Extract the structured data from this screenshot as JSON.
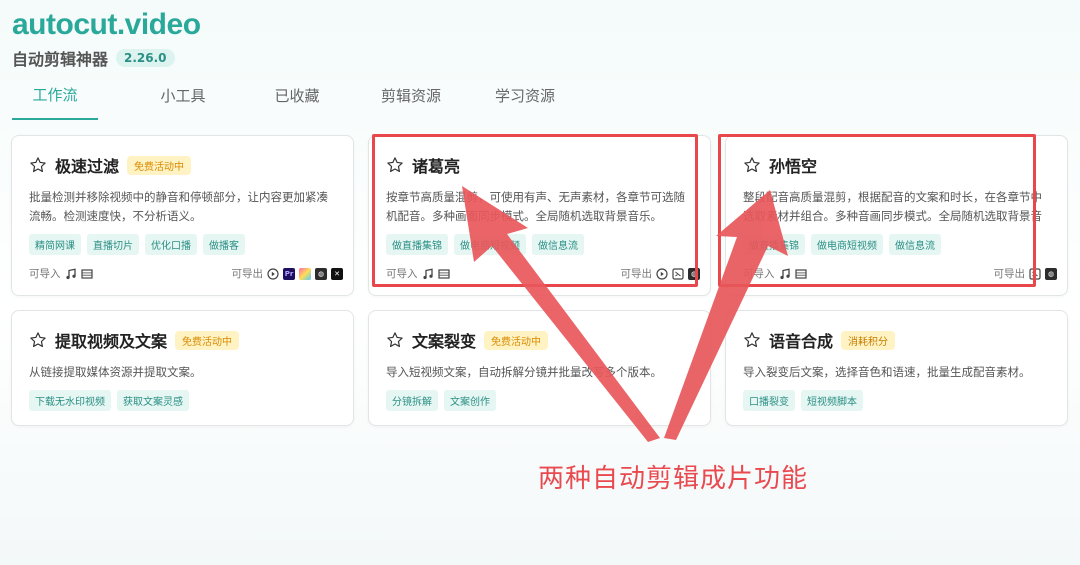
{
  "brand": {
    "logo": "autocut.video",
    "tagline": "自动剪辑神器",
    "version": "2.26.0"
  },
  "tabs": [
    {
      "label": "工作流",
      "active": true
    },
    {
      "label": "小工具",
      "active": false
    },
    {
      "label": "已收藏",
      "active": false
    },
    {
      "label": "剪辑资源",
      "active": false
    },
    {
      "label": "学习资源",
      "active": false
    }
  ],
  "labels": {
    "import": "可导入",
    "export": "可导出"
  },
  "cards": [
    {
      "title": "极速过滤",
      "badge": "免费活动中",
      "desc": "批量检测并移除视频中的静音和停顿部分，让内容更加紧凑流畅。检测速度快，不分析语义。",
      "tags": [
        "精简网课",
        "直播切片",
        "优化口播",
        "做播客"
      ]
    },
    {
      "title": "诸葛亮",
      "badge": "",
      "desc": "按章节高质量混剪，可使用有声、无声素材，各章节可选随机配音。多种画面同步模式。全局随机选取背景音乐。",
      "tags": [
        "做直播集锦",
        "做电商短视频",
        "做信息流"
      ]
    },
    {
      "title": "孙悟空",
      "badge": "",
      "desc": "整段配音高质量混剪，根据配音的文案和时长，在各章节中选取素材并组合。多种音画同步模式。全局随机选取背景音乐。",
      "tags": [
        "做直播集锦",
        "做电商短视频",
        "做信息流"
      ]
    },
    {
      "title": "提取视频及文案",
      "badge": "免费活动中",
      "desc": "从链接提取媒体资源并提取文案。",
      "tags": [
        "下载无水印视频",
        "获取文案灵感"
      ]
    },
    {
      "title": "文案裂变",
      "badge": "免费活动中",
      "desc": "导入短视频文案，自动拆解分镜并批量改写多个版本。",
      "tags": [
        "分镜拆解",
        "文案创作"
      ]
    },
    {
      "title": "语音合成",
      "badge": "消耗积分",
      "desc": "导入裂变后文案，选择音色和语速，批量生成配音素材。",
      "tags": [
        "口播裂变",
        "短视频脚本"
      ]
    }
  ],
  "export_icons": {
    "card0": [
      "play-circle-icon",
      "premiere-pro-icon",
      "final-cut-icon",
      "davinci-resolve-icon",
      "capcut-icon"
    ],
    "card1": [
      "play-circle-icon",
      "jianying-icon",
      "davinci-resolve-icon"
    ],
    "card2": [
      "jianying-icon",
      "davinci-resolve-icon"
    ]
  },
  "annotation": {
    "text": "两种自动剪辑成片功能",
    "color": "#e84a4f"
  },
  "colors": {
    "accent": "#2aa99b",
    "badge_bg": "#fff3c4",
    "badge_text": "#d98a00",
    "tag_bg": "#e6f6f3",
    "annotation": "#e8474c"
  }
}
